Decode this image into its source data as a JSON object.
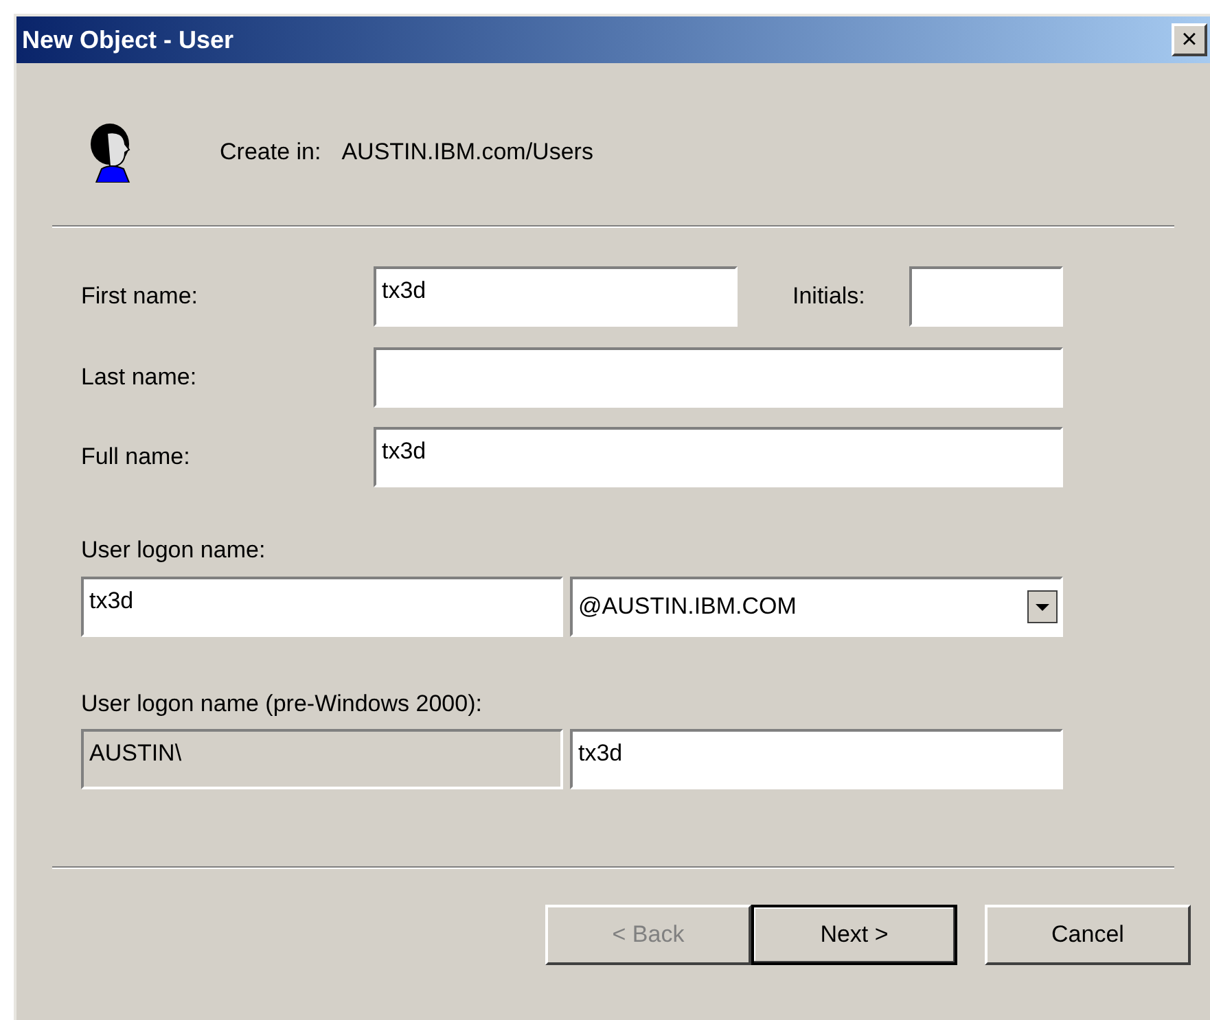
{
  "window": {
    "title": "New Object - User",
    "close": "×"
  },
  "header": {
    "label": "Create in:",
    "value": "AUSTIN.IBM.com/Users"
  },
  "first_name": {
    "label": "First name:",
    "value": "tx3d"
  },
  "initials": {
    "label": "Initials:"
  },
  "last_name": {
    "label": "Last name:"
  },
  "full_name": {
    "label": "Full name:",
    "value": "tx3d"
  },
  "logon": {
    "label": "User logon name:",
    "value": "tx3d",
    "domain": "@AUSTIN.IBM.COM"
  },
  "pre_windows": {
    "label": "User logon name (pre-Windows 2000):",
    "prefix": {
      "value": "AUSTIN\\",
      "disabled": true
    },
    "name": {
      "value": "tx3d",
      "disabled": false
    }
  },
  "buttons": [
    {
      "label": "< Back",
      "disabled": true,
      "default": false
    },
    {
      "label": "Next >",
      "disabled": false,
      "default": true
    },
    {
      "label": "Cancel",
      "disabled": false,
      "default": false
    }
  ]
}
